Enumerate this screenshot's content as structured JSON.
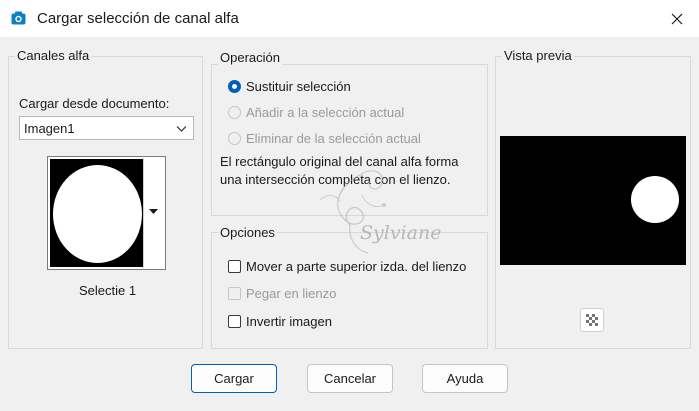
{
  "window": {
    "title": "Cargar selección de canal alfa",
    "close_icon": "close-icon",
    "app_icon": "camera-icon"
  },
  "alpha_channels": {
    "legend": "Canales alfa",
    "load_from_label": "Cargar desde documento:",
    "document_value": "Imagen1",
    "selection_label": "Selectie 1"
  },
  "operation": {
    "legend": "Operación",
    "options": [
      {
        "label": "Sustituir selección",
        "selected": true,
        "enabled": true
      },
      {
        "label": "Añadir a la selección actual",
        "selected": false,
        "enabled": false
      },
      {
        "label": "Eliminar de la selección actual",
        "selected": false,
        "enabled": false
      }
    ],
    "description": "El rectángulo original del canal alfa forma una intersección completa con el lienzo."
  },
  "options": {
    "legend": "Opciones",
    "checks": [
      {
        "label": "Mover a parte superior izda. del lienzo",
        "checked": false,
        "enabled": true
      },
      {
        "label": "Pegar en lienzo",
        "checked": false,
        "enabled": false
      },
      {
        "label": "Invertir imagen",
        "checked": false,
        "enabled": true
      }
    ]
  },
  "preview": {
    "legend": "Vista previa",
    "checker_icon": "checkerboard-icon"
  },
  "buttons": {
    "load": "Cargar",
    "cancel": "Cancelar",
    "help": "Ayuda"
  },
  "watermark": {
    "text": "Sylviane"
  },
  "colors": {
    "accent": "#005fb8",
    "background": "#f0f0f0",
    "title_bar": "#ffffff"
  }
}
